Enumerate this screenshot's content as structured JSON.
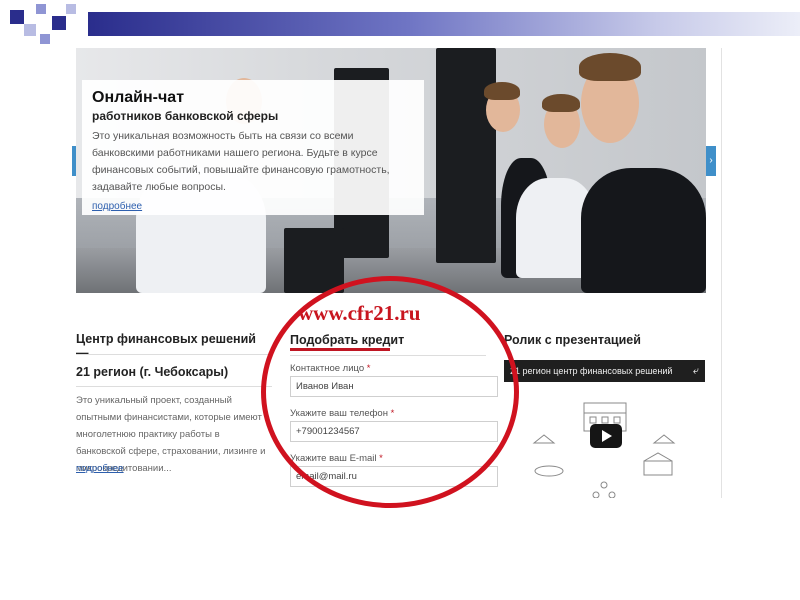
{
  "banner": {
    "title": "Онлайн-чат",
    "subtitle": "работников банковской сферы",
    "text": "Это уникальная возможность быть на связи со всеми банковскими работниками нашего региона. Будьте в курсе финансовых событий, повышайте финансовую грамотность, задавайте любые вопросы.",
    "more_link": "подробнее",
    "next_arrow": "›"
  },
  "center": {
    "title": "Центр финансовых решений —",
    "region": "21 регион (г. Чебоксары)",
    "text": "Это уникальный проект, созданный опытными финансистами, которые имеют многолетнюю практику работы в банковской сфере, страховании, лизинге и микрокредитовании...",
    "more_link": "подробнее"
  },
  "credit_form": {
    "title": "Подобрать кредит",
    "fields": [
      {
        "label": "Контактное лицо",
        "required_mark": "*",
        "value": "Иванов Иван"
      },
      {
        "label": "Укажите ваш телефон",
        "required_mark": "*",
        "value": "+79001234567"
      },
      {
        "label": "Укажите ваш E-mail",
        "required_mark": "*",
        "value": "email@mail.ru"
      }
    ]
  },
  "video": {
    "title": "Ролик с презентацией",
    "player_title": "21 регион центр финансовых решений",
    "share_icon": "share-icon",
    "play_icon": "play-icon"
  },
  "annotation": {
    "url": "www.cfr21.ru",
    "color": "#d0121f"
  },
  "colors": {
    "accent_red": "#c01623",
    "link_blue": "#2d5fae",
    "slide_bar_dark": "#2a2d8c"
  }
}
